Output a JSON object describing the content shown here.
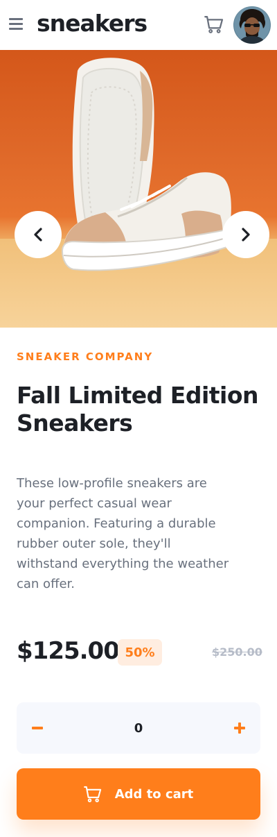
{
  "header": {
    "brand": "sneakers",
    "menu_icon": "hamburger-menu-icon",
    "cart_icon": "cart-icon",
    "avatar_icon": "user-avatar"
  },
  "gallery": {
    "image": "white-and-tan-low-top-sneakers-on-orange-background",
    "prev_icon": "chevron-left-icon",
    "next_icon": "chevron-right-icon"
  },
  "product": {
    "company": "SNEAKER COMPANY",
    "title": "Fall Limited Edition Sneakers",
    "description": "These low-profile sneakers are your perfect casual wear companion. Featuring a durable rubber outer sole, they'll withstand everything the weather can offer.",
    "price": "$125.00",
    "discount": "50%",
    "original_price": "$250.00"
  },
  "quantity": {
    "value": "0",
    "minus_icon": "minus-icon",
    "plus_icon": "plus-icon"
  },
  "cart_button": {
    "label": "Add to cart",
    "icon": "cart-icon"
  },
  "colors": {
    "accent": "#ff7e1b",
    "accent_pale": "#ffede0",
    "text_dark": "#1d2026",
    "text_gray": "#68707d",
    "text_light": "#b6bcc8",
    "quantity_bg": "#f6f8fd"
  }
}
